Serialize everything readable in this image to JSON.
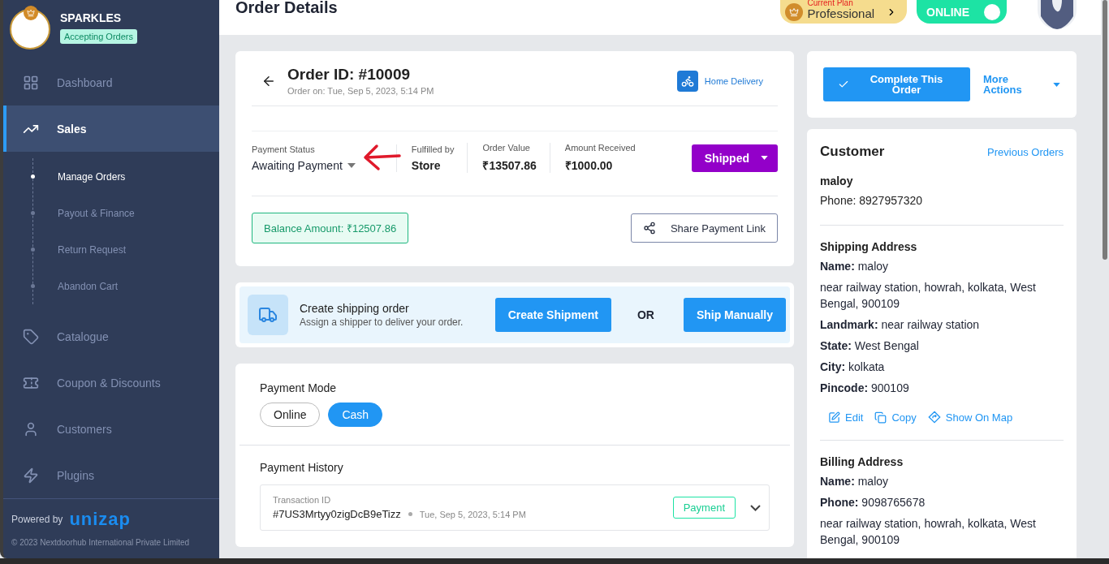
{
  "sidebar": {
    "store_name": "SPARKLES",
    "store_status": "Accepting Orders",
    "nav": [
      {
        "label": "Dashboard",
        "selected": false
      },
      {
        "label": "Sales",
        "selected": true,
        "expanded": true,
        "children": [
          {
            "label": "Manage Orders",
            "selected": true
          },
          {
            "label": "Payout & Finance",
            "selected": false
          },
          {
            "label": "Return Request",
            "selected": false
          },
          {
            "label": "Abandon Cart",
            "selected": false
          }
        ]
      },
      {
        "label": "Catalogue",
        "selected": false
      },
      {
        "label": "Coupon & Discounts",
        "selected": false
      },
      {
        "label": "Customers",
        "selected": false
      },
      {
        "label": "Plugins",
        "selected": false
      }
    ],
    "powered_by": "Powered by",
    "brand": "unizap",
    "copyright": "© 2023 Nextdoorhub International Private Limited"
  },
  "header": {
    "title": "Order Details",
    "plan_label": "Current Plan",
    "plan_name": "Professional",
    "status": {
      "label": "ONLINE",
      "on": true
    }
  },
  "order": {
    "title": "Order ID: #10009",
    "date": "Order on: Tue, Sep 5, 2023, 5:14 PM",
    "delivery": "Home Delivery",
    "stats": [
      {
        "label": "Payment Status",
        "value": "Awaiting Payment",
        "kind": "dropdown"
      },
      {
        "label": "Fulfilled by",
        "value": "Store",
        "kind": "text"
      },
      {
        "label": "Order Value",
        "value": "₹13507.86",
        "kind": "text"
      },
      {
        "label": "Amount Received",
        "value": "₹1000.00",
        "kind": "text"
      }
    ],
    "status_button": "Shipped",
    "balance": "Balance Amount: ₹12507.86",
    "share": "Share Payment Link"
  },
  "shipping": {
    "title": "Create shipping order",
    "subtitle": "Assign a shipper to deliver your order.",
    "create": "Create Shipment",
    "or": "OR",
    "manual": "Ship Manually"
  },
  "payment": {
    "mode_title": "Payment Mode",
    "modes": [
      {
        "label": "Online",
        "selected": false
      },
      {
        "label": "Cash",
        "selected": true
      }
    ],
    "history_title": "Payment History",
    "transactions": [
      {
        "label": "Transaction ID",
        "id": "#7US3Mrtyy0zigDcB9eTizz",
        "date": "Tue, Sep 5, 2023, 5:14 PM",
        "type": "Payment",
        "expanded": false
      }
    ]
  },
  "actions": {
    "complete": "Complete This Order",
    "more": "More Actions"
  },
  "customer": {
    "title": "Customer",
    "link": "Previous Orders",
    "name": "maloy",
    "phone": "Phone: 8927957320",
    "sections": [
      {
        "title": "Shipping Address",
        "lines": [
          "**Name:** maloy",
          "near railway station, howrah, kolkata, West Bengal, 900109",
          "**Landmark:** near railway station",
          "**State:** West Bengal",
          "**City:** kolkata",
          "**Pincode:** 900109"
        ],
        "actions": [
          "Edit",
          "Copy",
          "Show On Map"
        ]
      },
      {
        "title": "Billing Address",
        "lines": [
          "**Name:** maloy",
          "**Phone:** 9098765678",
          "near railway station, howrah, kolkata, West Bengal, 900109"
        ]
      }
    ]
  }
}
